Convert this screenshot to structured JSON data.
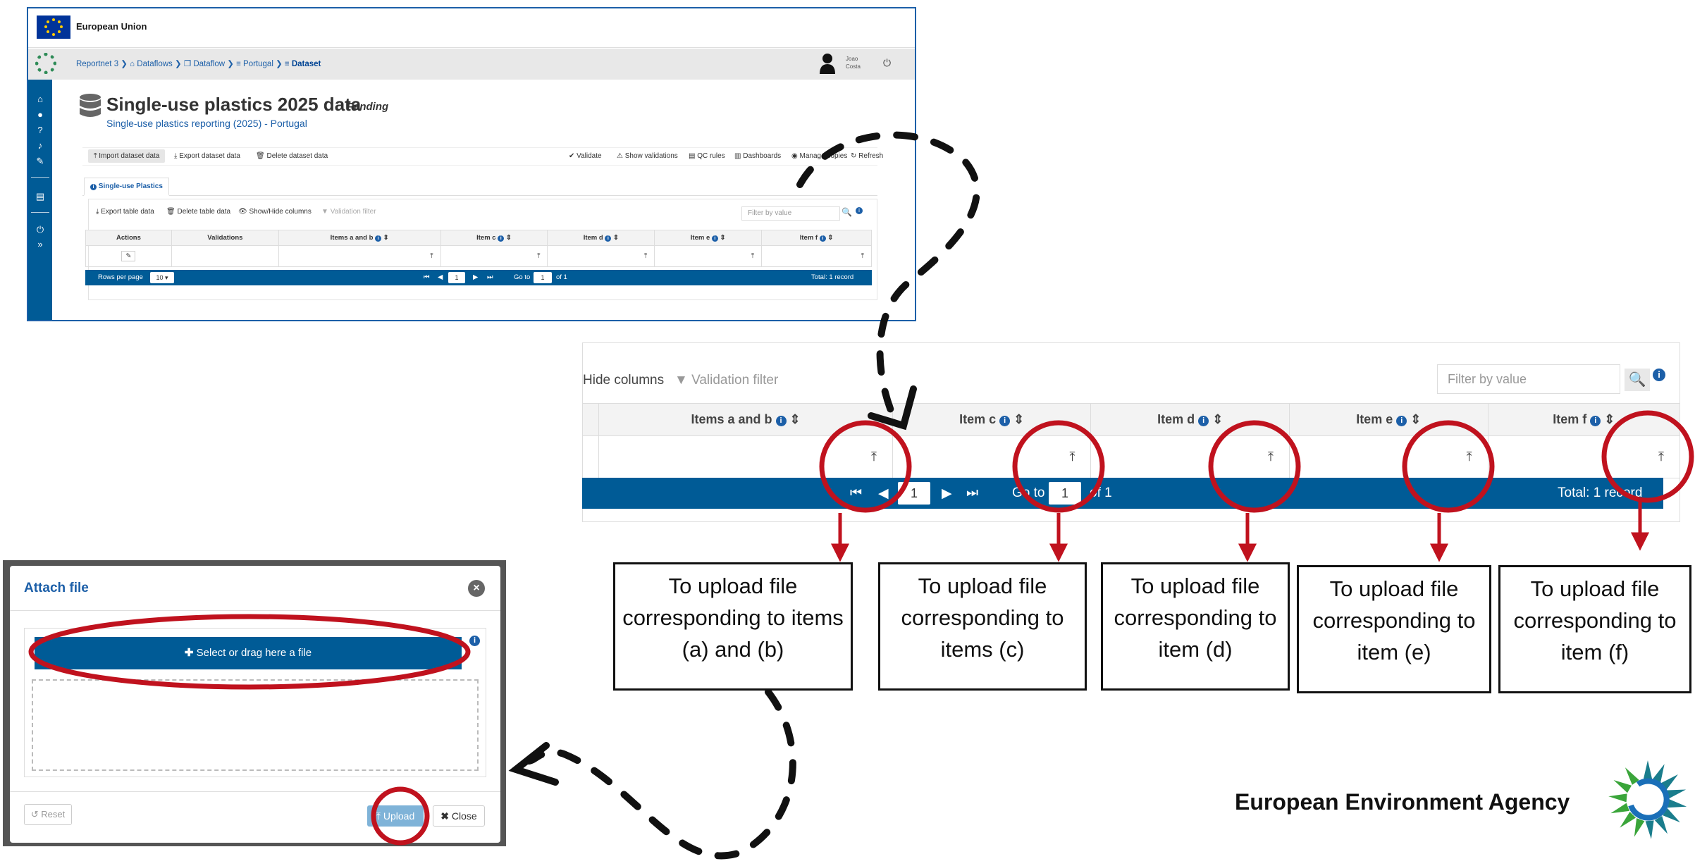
{
  "eu": {
    "label": "European Union"
  },
  "breadcrumb": {
    "items": [
      {
        "icon": "",
        "label": "Reportnet 3"
      },
      {
        "icon": "⌂",
        "label": "Dataflows"
      },
      {
        "icon": "❐",
        "label": "Dataflow"
      },
      {
        "icon": "≡",
        "label": "Portugal"
      },
      {
        "icon": "≡",
        "label": "Dataset"
      }
    ],
    "separator": " ❯ "
  },
  "user": {
    "name_line1": "Joao",
    "name_line2": "Costa"
  },
  "dataset": {
    "title": "Single-use plastics 2025 data",
    "status": "Pending",
    "subtitle": "Single-use plastics reporting (2025) - Portugal"
  },
  "toolbar": {
    "import": "Import dataset data",
    "export": "Export dataset data",
    "delete": "Delete dataset data",
    "validate": "Validate",
    "show_validations": "Show validations",
    "qc_rules": "QC rules",
    "dashboards": "Dashboards",
    "manage_copies": "Manage copies",
    "refresh": "Refresh"
  },
  "tab": {
    "label": "Single-use Plastics"
  },
  "table_toolbar": {
    "export": "Export table data",
    "delete": "Delete table data",
    "show_hide": "Show/Hide columns",
    "show_hide_partial": "Hide columns",
    "validation_filter": "Validation filter",
    "filter_placeholder": "Filter by value"
  },
  "table": {
    "columns": [
      "Actions",
      "Validations",
      "Items a and b",
      "Item c",
      "Item d",
      "Item e",
      "Item f"
    ],
    "upload_glyph": "⤒"
  },
  "pager": {
    "rows_per_page_label": "Rows per page",
    "rows_per_page": "10",
    "page": "1",
    "go_to_label": "Go to",
    "go_to_value": "1",
    "of_label": "of 1",
    "total": "Total: 1 record"
  },
  "callouts": [
    "To upload file corresponding to items (a) and (b)",
    "To upload file corresponding to items (c)",
    "To upload file corresponding to item (d)",
    "To upload file corresponding to item (e)",
    "To upload file corresponding to item (f)"
  ],
  "dialog": {
    "title": "Attach file",
    "select_label": "Select or drag here a file",
    "reset_label": "Reset",
    "upload_label": "Upload",
    "close_label": "Close"
  },
  "agency": {
    "name": "European Environment Agency"
  },
  "colors": {
    "primary": "#005b96",
    "link": "#1c5fa8",
    "highlight_red": "#c0121e",
    "eu_blue": "#003399",
    "eu_gold": "#ffcc00"
  }
}
